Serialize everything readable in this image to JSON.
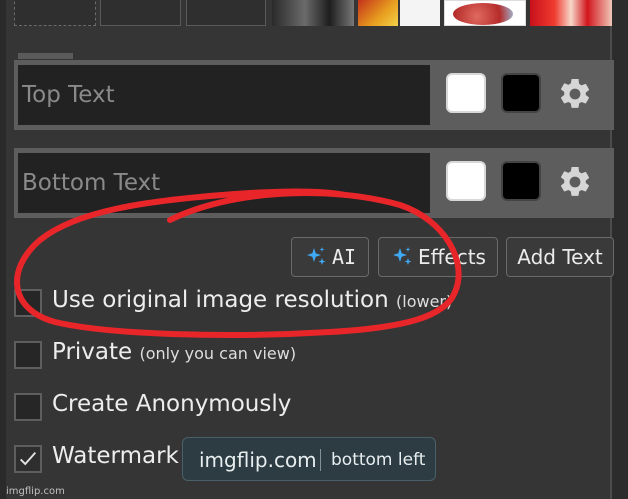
{
  "top_text": {
    "placeholder": "Top Text"
  },
  "bottom_text": {
    "placeholder": "Bottom Text"
  },
  "buttons": {
    "ai": "AI",
    "effects": "Effects",
    "add_text": "Add Text"
  },
  "options": {
    "original_res": {
      "label": "Use original image resolution",
      "note": "(lower)",
      "checked": false
    },
    "private": {
      "label": "Private",
      "note": "(only you can view)",
      "checked": false
    },
    "anonymous": {
      "label": "Create Anonymously",
      "checked": false
    },
    "watermark": {
      "label": "Watermark",
      "checked": true
    }
  },
  "watermark": {
    "site": "imgflip.com",
    "position": "bottom left"
  },
  "footer": {
    "credit": "imgflip.com"
  },
  "colors": {
    "annotation": "#e8262a",
    "sparkle": "#3fa9f5",
    "background": "#353535"
  },
  "icons": [
    "gear-icon",
    "sparkle-icon",
    "checkmark-icon"
  ]
}
